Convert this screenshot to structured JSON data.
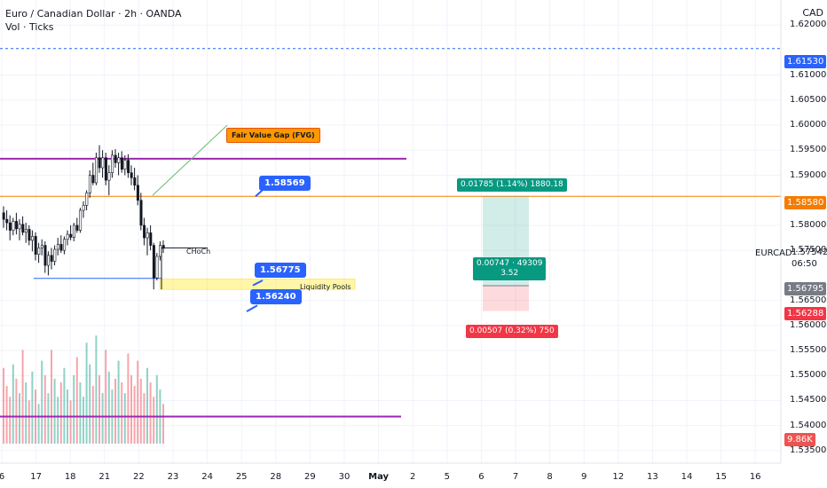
{
  "header": {
    "title": "Euro / Canadian Dollar · 2h · OANDA",
    "indicator": "Vol · Ticks",
    "currency": "CAD"
  },
  "price_axis": {
    "labels": [
      "1.62000",
      "1.61000",
      "1.60500",
      "1.60000",
      "1.59500",
      "1.59000",
      "1.58000",
      "1.57500",
      "1.56500",
      "1.56000",
      "1.55500",
      "1.55000",
      "1.54500",
      "1.54000",
      "1.53500"
    ],
    "tags": {
      "dashed_level": {
        "text": "1.61530",
        "color": "#2962ff"
      },
      "entry": {
        "text": "1.58580",
        "color": "#f57c00"
      },
      "current": {
        "text": "1.56795",
        "color": "#787b86"
      },
      "stop": {
        "text": "1.56288",
        "color": "#f23645"
      },
      "volume": {
        "text": "9.86K",
        "color": "#ef5350"
      }
    },
    "symbol": "EURCAD",
    "last_price": "1.57542",
    "countdown": "06:50"
  },
  "time_axis": {
    "labels": [
      "6",
      "17",
      "18",
      "21",
      "22",
      "23",
      "24",
      "25",
      "28",
      "29",
      "30",
      "May",
      "2",
      "5",
      "6",
      "7",
      "8",
      "9",
      "12",
      "13",
      "14",
      "15",
      "16"
    ],
    "bold_index": 11
  },
  "annotations": {
    "fvg_label": "Fair Value Gap (FVG)",
    "level_upper": "1.58569",
    "level_mid": "1.56775",
    "level_low": "1.56240",
    "choch": "CHoCh",
    "liquidity": "Liquidity Pools",
    "target_box": "0.01785 (1.14%) 1880.18",
    "mid_box_line1": "0.00747 · 49309",
    "mid_box_line2": "3.52",
    "stop_box": "0.00507 (0.32%) 750"
  },
  "colors": {
    "up": "#089981",
    "down": "#f23645",
    "purple": "#9c27b0",
    "blue": "#2962ff",
    "orange": "#f57c00"
  },
  "chart_data": {
    "type": "candlestick",
    "symbol": "EURCAD",
    "timeframe": "2h",
    "ohlc": [
      [
        1.5825,
        1.5838,
        1.5795,
        1.5812
      ],
      [
        1.5812,
        1.583,
        1.579,
        1.5805
      ],
      [
        1.5805,
        1.582,
        1.577,
        1.579
      ],
      [
        1.579,
        1.5815,
        1.578,
        1.5808
      ],
      [
        1.5808,
        1.5825,
        1.5782,
        1.5793
      ],
      [
        1.5793,
        1.5812,
        1.577,
        1.5802
      ],
      [
        1.5802,
        1.5818,
        1.578,
        1.5786
      ],
      [
        1.5786,
        1.5805,
        1.5765,
        1.5792
      ],
      [
        1.5792,
        1.58,
        1.576,
        1.577
      ],
      [
        1.577,
        1.579,
        1.5748,
        1.5778
      ],
      [
        1.5778,
        1.5786,
        1.573,
        1.5742
      ],
      [
        1.5742,
        1.5765,
        1.5725,
        1.5755
      ],
      [
        1.5755,
        1.5772,
        1.574,
        1.576
      ],
      [
        1.576,
        1.5768,
        1.5705,
        1.572
      ],
      [
        1.572,
        1.5748,
        1.57,
        1.574
      ],
      [
        1.574,
        1.5755,
        1.5712,
        1.5728
      ],
      [
        1.5728,
        1.576,
        1.572,
        1.5752
      ],
      [
        1.5752,
        1.5775,
        1.574,
        1.5762
      ],
      [
        1.5762,
        1.578,
        1.5745,
        1.575
      ],
      [
        1.575,
        1.5778,
        1.5742,
        1.5772
      ],
      [
        1.5772,
        1.579,
        1.576,
        1.5782
      ],
      [
        1.5782,
        1.58,
        1.577,
        1.5776
      ],
      [
        1.5776,
        1.5805,
        1.5768,
        1.58
      ],
      [
        1.58,
        1.5815,
        1.5785,
        1.579
      ],
      [
        1.579,
        1.5835,
        1.5785,
        1.583
      ],
      [
        1.583,
        1.5848,
        1.5815,
        1.584
      ],
      [
        1.584,
        1.587,
        1.583,
        1.5865
      ],
      [
        1.5865,
        1.591,
        1.5855,
        1.59
      ],
      [
        1.59,
        1.5925,
        1.588,
        1.5885
      ],
      [
        1.5885,
        1.5945,
        1.588,
        1.5935
      ],
      [
        1.5935,
        1.596,
        1.5905,
        1.5915
      ],
      [
        1.5915,
        1.595,
        1.5895,
        1.5935
      ],
      [
        1.5935,
        1.5945,
        1.588,
        1.589
      ],
      [
        1.589,
        1.592,
        1.586,
        1.5905
      ],
      [
        1.5905,
        1.595,
        1.5895,
        1.594
      ],
      [
        1.594,
        1.5952,
        1.5915,
        1.5925
      ],
      [
        1.5925,
        1.5945,
        1.59,
        1.5935
      ],
      [
        1.5935,
        1.5948,
        1.5905,
        1.5912
      ],
      [
        1.5912,
        1.594,
        1.59,
        1.593
      ],
      [
        1.593,
        1.5942,
        1.5895,
        1.5905
      ],
      [
        1.5905,
        1.592,
        1.588,
        1.5895
      ],
      [
        1.5895,
        1.5915,
        1.587,
        1.588
      ],
      [
        1.588,
        1.59,
        1.584,
        1.585
      ],
      [
        1.585,
        1.5865,
        1.579,
        1.58
      ],
      [
        1.58,
        1.5815,
        1.576,
        1.5775
      ],
      [
        1.5775,
        1.5795,
        1.574,
        1.5785
      ],
      [
        1.5785,
        1.58,
        1.575,
        1.576
      ],
      [
        1.576,
        1.5765,
        1.5672,
        1.5695
      ],
      [
        1.5695,
        1.5745,
        1.569,
        1.5738
      ],
      [
        1.5738,
        1.5768,
        1.573,
        1.576
      ],
      [
        1.576,
        1.577,
        1.5745,
        1.5754
      ]
    ],
    "volume": [
      210,
      160,
      130,
      220,
      180,
      140,
      260,
      170,
      120,
      200,
      150,
      110,
      230,
      190,
      140,
      260,
      180,
      130,
      170,
      210,
      150,
      120,
      190,
      240,
      170,
      130,
      280,
      220,
      160,
      300,
      190,
      140,
      260,
      200,
      150,
      180,
      230,
      170,
      140,
      250,
      190,
      160,
      230,
      180,
      140,
      210,
      170,
      130,
      190,
      150,
      110
    ],
    "levels": {
      "purple_upper": 1.5933,
      "purple_lower": 1.5418,
      "dashed_blue": 1.6153,
      "entry": 1.5858,
      "support": 1.5694,
      "stop": 1.56288,
      "take_profit": 1.5858,
      "current": 1.56795
    },
    "y_range": [
      1.5325,
      1.625
    ]
  }
}
